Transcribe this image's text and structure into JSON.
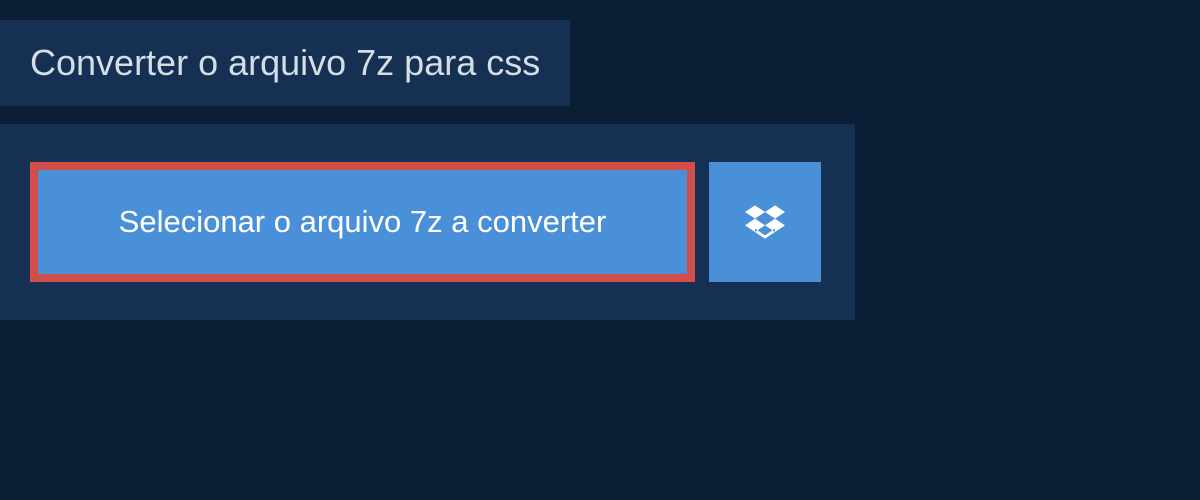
{
  "header": {
    "title": "Converter o arquivo 7z para css"
  },
  "upload": {
    "select_label": "Selecionar o arquivo 7z a converter"
  },
  "colors": {
    "background": "#0a1e35",
    "panel": "#153052",
    "button": "#4a90d9",
    "highlight_border": "#d14f48",
    "text_light": "#ffffff",
    "text_header": "#d5dde5"
  }
}
